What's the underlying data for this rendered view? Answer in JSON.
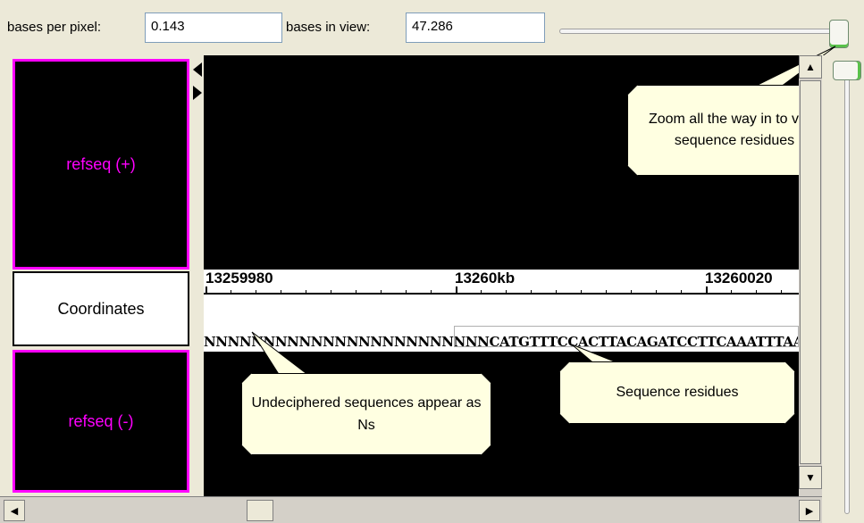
{
  "toolbar": {
    "bases_per_pixel_label": "bases per pixel:",
    "bases_per_pixel_value": "0.143",
    "bases_in_view_label": "bases in view:",
    "bases_in_view_value": "47.286"
  },
  "tracks": {
    "plus_label": "refseq (+)",
    "coordinates_label": "Coordinates",
    "minus_label": "refseq (-)",
    "accent_color": "#ff00ff"
  },
  "ruler": {
    "ticks": [
      "13259980",
      "13260kb",
      "13260020"
    ]
  },
  "sequence": {
    "residues": "NNNNNNNNNNNNNNNNNNNNNNNNCATGTTTCCACTTACAGATCCTTCAAATTTAAG"
  },
  "callouts": {
    "zoom": "Zoom all the way in to view sequence residues",
    "undeciphered": "Undeciphered sequences appear as Ns",
    "residues": "Sequence residues"
  },
  "icons": {
    "scroll_up": "up-arrow-icon",
    "scroll_down": "down-arrow-icon",
    "scroll_left": "left-arrow-icon",
    "scroll_right": "right-arrow-icon"
  }
}
